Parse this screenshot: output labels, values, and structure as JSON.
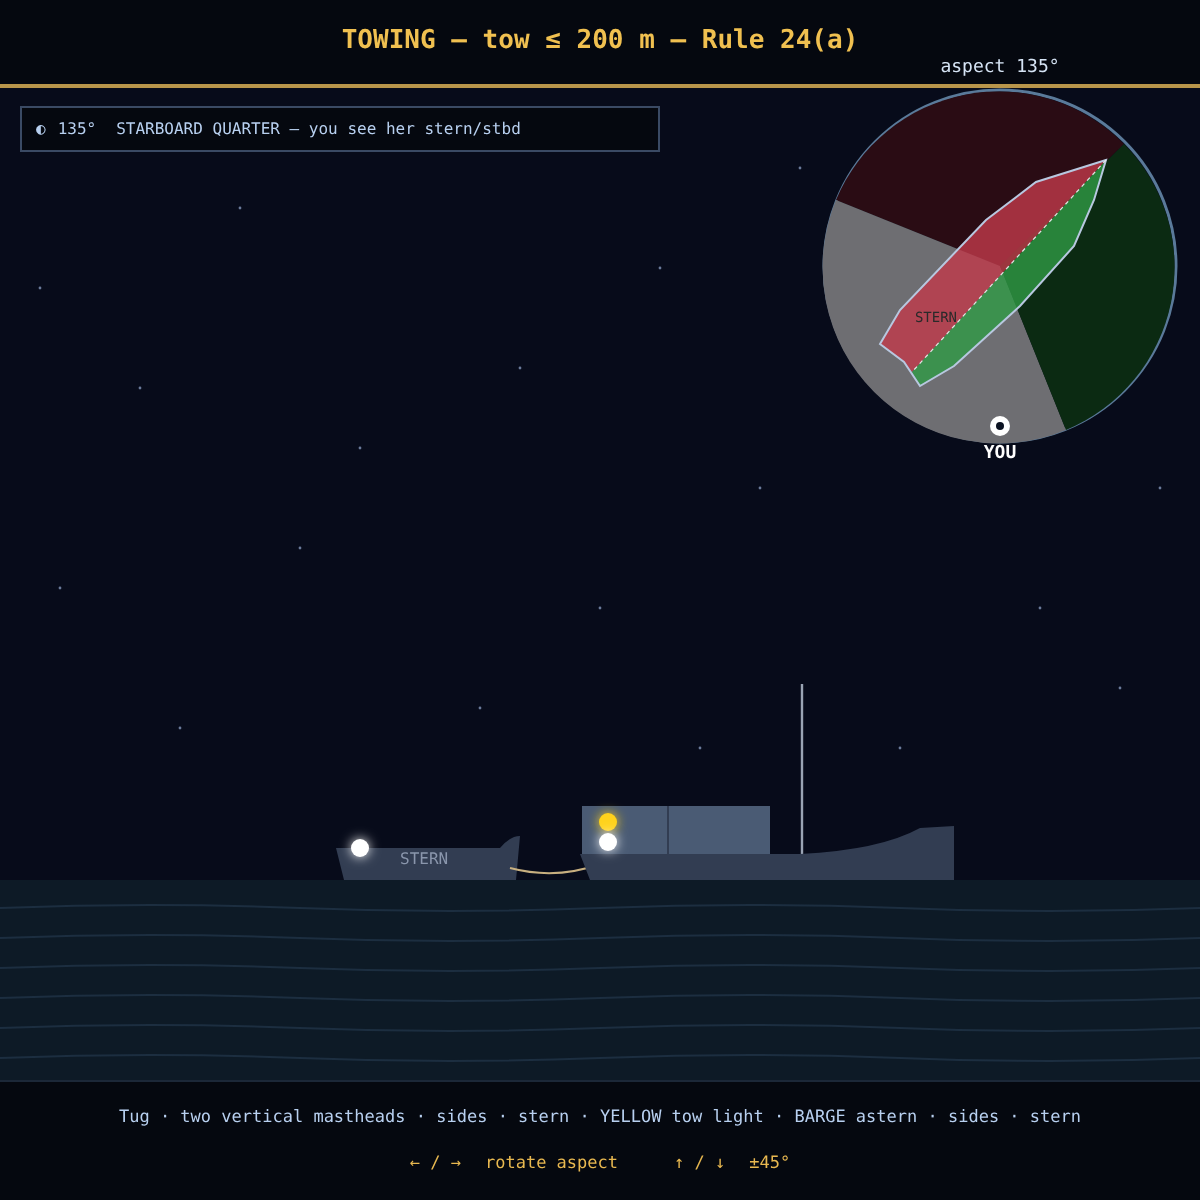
{
  "title": "TOWING — tow ≤ 200 m — Rule 24(a)",
  "aspect_info": {
    "icon": "◐",
    "angle": "135°",
    "description": "STARBOARD QUARTER — you see her stern/stbd"
  },
  "compass": {
    "label": "aspect 135°",
    "vessel_label": "STERN",
    "observer_label": "YOU"
  },
  "scene": {
    "barge_label": "STERN",
    "lights": [
      {
        "kind": "barge-stern",
        "color": "#ffffff"
      },
      {
        "kind": "tow",
        "color": "#ffd21a"
      },
      {
        "kind": "tug-stern",
        "color": "#ffffff"
      }
    ]
  },
  "legend": "Tug · two vertical mastheads · sides · stern · YELLOW tow light · BARGE astern · sides · stern",
  "keys": [
    {
      "keys": "← / →",
      "action": "rotate aspect"
    },
    {
      "keys": "↑ / ↓",
      "action": "±45°"
    }
  ]
}
